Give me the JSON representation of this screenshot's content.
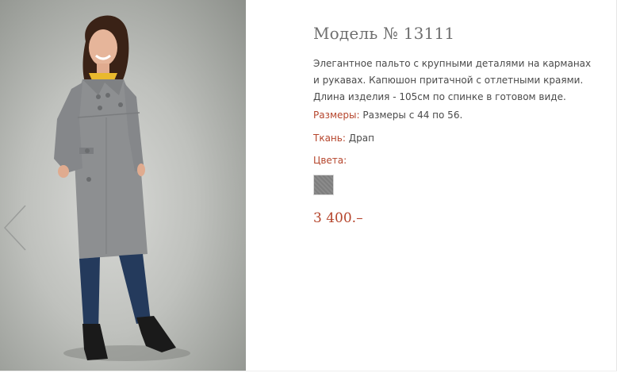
{
  "product": {
    "title": "Модель № 13111",
    "description": "Элегантное пальто с крупными деталями на карманах и рукавах. Капюшон притачной с отлетными краями. Длина изделия - 105см по спинке в готовом виде.",
    "sizes_label": "Размеры:",
    "sizes_value": "Размеры с 44 по 56.",
    "fabric_label": "Ткань:",
    "fabric_value": "Драп",
    "colors_label": "Цвета:",
    "colors": [
      {
        "name": "grey",
        "hex": "#848484"
      }
    ],
    "price": "3 400.–"
  },
  "gallery": {
    "prev_icon": "chevron-left-icon"
  },
  "theme": {
    "accent": "#b5452c",
    "title_color": "#6e6e6e",
    "text_color": "#4a4a4a"
  }
}
